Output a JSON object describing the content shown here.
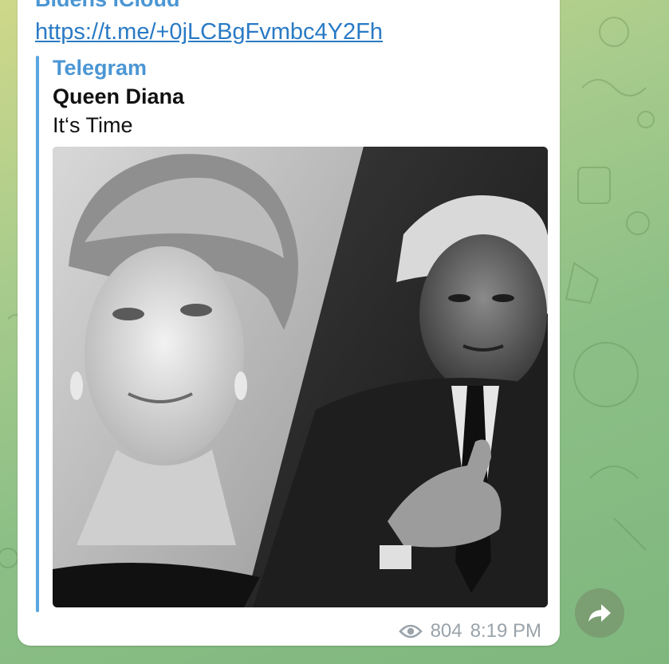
{
  "message": {
    "sender": "Bidens iCloud",
    "link_text": "https://t.me/+0jLCBgFvmbc4Y2Fh",
    "preview": {
      "site_name": "Telegram",
      "title": "Queen Diana",
      "description": "It‘s Time"
    },
    "views": "804",
    "time": "8:19 PM"
  },
  "icons": {
    "views": "eye-icon",
    "forward": "forward-arrow-icon"
  },
  "colors": {
    "accent": "#4b96d4",
    "link": "#2a7ac4",
    "meta": "#9aa3aa",
    "bubble": "#ffffff"
  }
}
